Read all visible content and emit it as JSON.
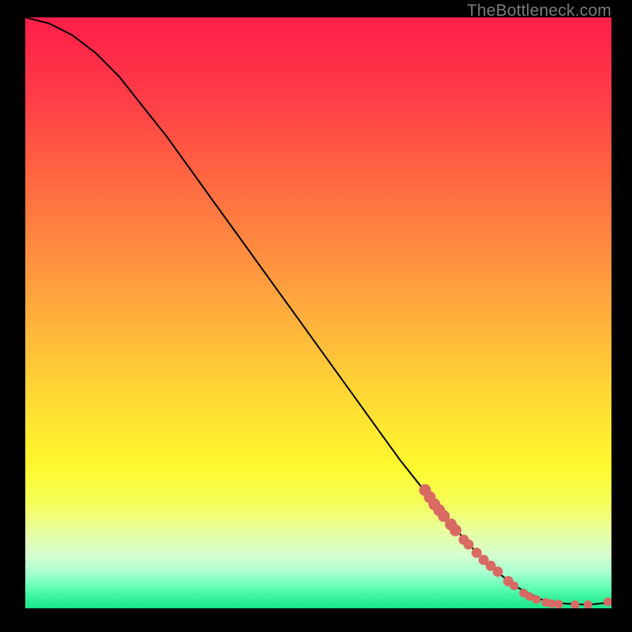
{
  "watermark": "TheBottleneck.com",
  "colors": {
    "dot": "#d86a63",
    "curve": "#000000",
    "frame": "#000000"
  },
  "chart_data": {
    "type": "line",
    "title": "",
    "xlabel": "",
    "ylabel": "",
    "xlim": [
      0,
      100
    ],
    "ylim": [
      0,
      100
    ],
    "grid": false,
    "series": [
      {
        "name": "curve",
        "x": [
          0,
          4,
          8,
          12,
          16,
          20,
          24,
          28,
          32,
          36,
          40,
          44,
          48,
          52,
          56,
          60,
          64,
          68,
          72,
          76,
          80,
          84,
          88,
          92,
          96,
          100
        ],
        "y": [
          100,
          99,
          97,
          94,
          90,
          85,
          80,
          74.5,
          69,
          63.5,
          58,
          52.5,
          47,
          41.5,
          36,
          30.5,
          25,
          20,
          15,
          10.5,
          6.5,
          3.5,
          1.5,
          0.8,
          0.6,
          1.0
        ]
      }
    ],
    "points": {
      "name": "highlighted-points",
      "x": [
        68.2,
        69.0,
        69.8,
        70.6,
        71.4,
        72.6,
        73.4,
        74.8,
        75.6,
        77.0,
        78.2,
        79.4,
        80.6,
        82.4,
        83.4,
        85.0,
        86.0,
        87.2,
        88.8,
        89.8,
        91.0,
        93.8,
        96.0,
        99.4
      ],
      "y": [
        20.0,
        18.8,
        17.6,
        16.6,
        15.6,
        14.2,
        13.2,
        11.6,
        10.8,
        9.4,
        8.2,
        7.2,
        6.2,
        4.6,
        3.8,
        2.6,
        2.0,
        1.5,
        1.0,
        0.8,
        0.7,
        0.6,
        0.6,
        1.1
      ]
    }
  }
}
